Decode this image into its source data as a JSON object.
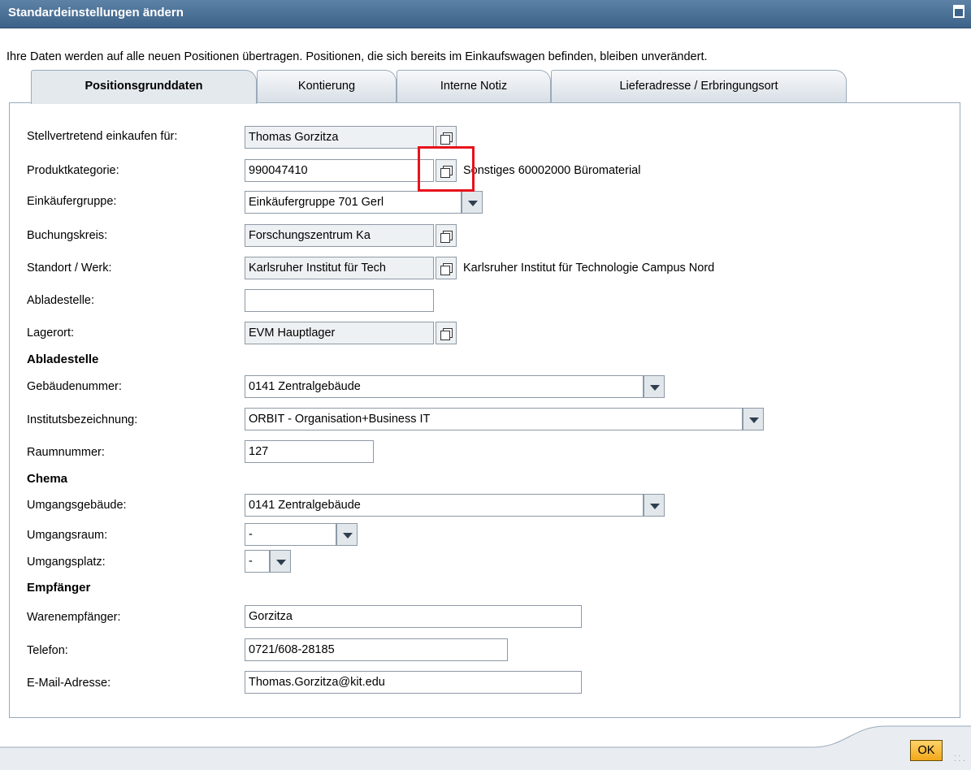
{
  "window": {
    "title": "Standardeinstellungen ändern"
  },
  "info_text": "Ihre Daten werden auf alle neuen Positionen übertragen. Positionen, die sich bereits im Einkaufswagen befinden, bleiben unverändert.",
  "tabs": [
    {
      "label": "Positionsgrunddaten",
      "active": true
    },
    {
      "label": "Kontierung",
      "active": false
    },
    {
      "label": "Interne Notiz",
      "active": false
    },
    {
      "label": "Lieferadresse / Erbringungsort",
      "active": false
    }
  ],
  "fields": {
    "stellvertretend": {
      "label": "Stellvertretend einkaufen für:",
      "value": "Thomas Gorzitza"
    },
    "produktkategorie": {
      "label": "Produktkategorie:",
      "value": "990047410",
      "description": "Sonstiges 60002000 Büromaterial"
    },
    "einkaeufergruppe": {
      "label": "Einkäufergruppe:",
      "value": "Einkäufergruppe 701 Gerl"
    },
    "buchungskreis": {
      "label": "Buchungskreis:",
      "value": "Forschungszentrum Ka"
    },
    "standort": {
      "label": "Standort / Werk:",
      "value": "Karlsruher Institut für Tech",
      "description": "Karlsruher Institut für Technologie Campus Nord"
    },
    "abladestelle": {
      "label": "Abladestelle:",
      "value": ""
    },
    "lagerort": {
      "label": "Lagerort:",
      "value": "EVM Hauptlager"
    }
  },
  "section_abladestelle": {
    "title": "Abladestelle",
    "gebaeudenummer": {
      "label": "Gebäudenummer:",
      "value": "0141 Zentralgebäude"
    },
    "institut": {
      "label": "Institutsbezeichnung:",
      "value": "ORBIT - Organisation+Business IT"
    },
    "raumnummer": {
      "label": "Raumnummer:",
      "value": "127"
    }
  },
  "section_chema": {
    "title": "Chema",
    "umgangsgebaeude": {
      "label": "Umgangsgebäude:",
      "value": "0141 Zentralgebäude"
    },
    "umgangsraum": {
      "label": "Umgangsraum:",
      "value": "-"
    },
    "umgangsplatz": {
      "label": "Umgangsplatz:",
      "value": "-"
    }
  },
  "section_empfaenger": {
    "title": "Empfänger",
    "warenempfaenger": {
      "label": "Warenempfänger:",
      "value": "Gorzitza"
    },
    "telefon": {
      "label": "Telefon:",
      "value": "0721/608-28185"
    },
    "email": {
      "label": "E-Mail-Adresse:",
      "value": "Thomas.Gorzitza@kit.edu"
    }
  },
  "footer": {
    "ok_label": "OK"
  },
  "colors": {
    "title_bar": "#4a6f96",
    "highlight": "#e8121c",
    "ok_button": "#f5b83a"
  }
}
